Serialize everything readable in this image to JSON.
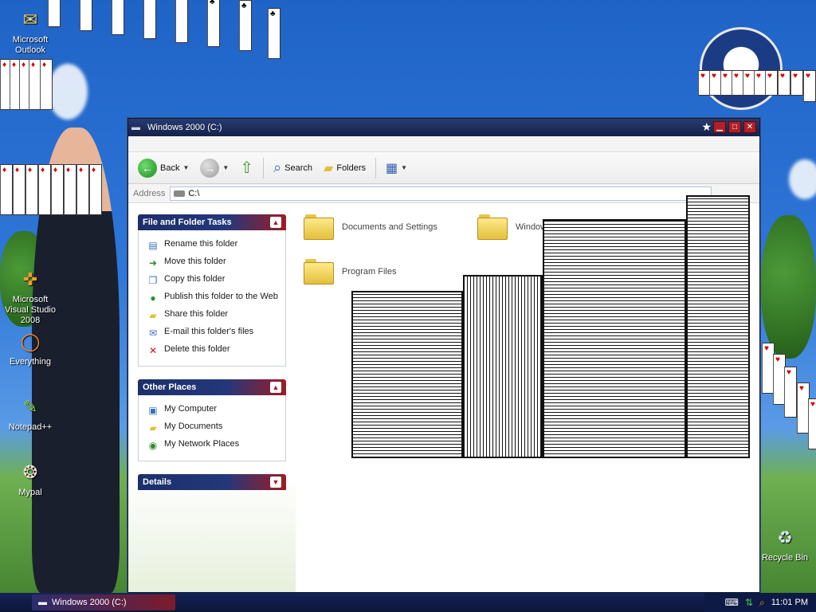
{
  "desktop": {
    "icons": [
      {
        "label": "Microsoft Outlook"
      },
      {
        "label": "Microsoft Visual Studio 2008"
      },
      {
        "label": "Everything"
      },
      {
        "label": "Notepad++"
      },
      {
        "label": "Mypal"
      },
      {
        "label": "Recycle Bin"
      }
    ]
  },
  "window": {
    "title": "Windows 2000 (C:)",
    "toolbar": {
      "back_label": "Back",
      "search_label": "Search",
      "folders_label": "Folders"
    },
    "address": {
      "label": "Address",
      "value": "C:\\"
    },
    "panels": {
      "tasks": {
        "title": "File and Folder Tasks",
        "items": [
          {
            "label": "Rename this folder",
            "icon": "rename-icon"
          },
          {
            "label": "Move this folder",
            "icon": "move-icon"
          },
          {
            "label": "Copy this folder",
            "icon": "copy-icon"
          },
          {
            "label": "Publish this folder to the Web",
            "icon": "web-publish-icon"
          },
          {
            "label": "Share this folder",
            "icon": "share-icon"
          },
          {
            "label": "E-mail this folder's files",
            "icon": "email-icon"
          },
          {
            "label": "Delete this folder",
            "icon": "delete-icon"
          }
        ]
      },
      "places": {
        "title": "Other Places",
        "items": [
          {
            "label": "My Computer",
            "icon": "computer-icon"
          },
          {
            "label": "My Documents",
            "icon": "documents-icon"
          },
          {
            "label": "My Network Places",
            "icon": "network-icon"
          }
        ]
      },
      "details": {
        "title": "Details"
      }
    },
    "folders": [
      {
        "name": "Documents and Settings"
      },
      {
        "name": "Windows"
      },
      {
        "name": "Program Files"
      }
    ]
  },
  "taskbar": {
    "active_task": "Windows 2000 (C:)",
    "clock": "11:01 PM"
  },
  "colors": {
    "panel_blue": "#1b2f6a",
    "panel_red": "#9e1c24",
    "title_blue": "#14224a"
  }
}
